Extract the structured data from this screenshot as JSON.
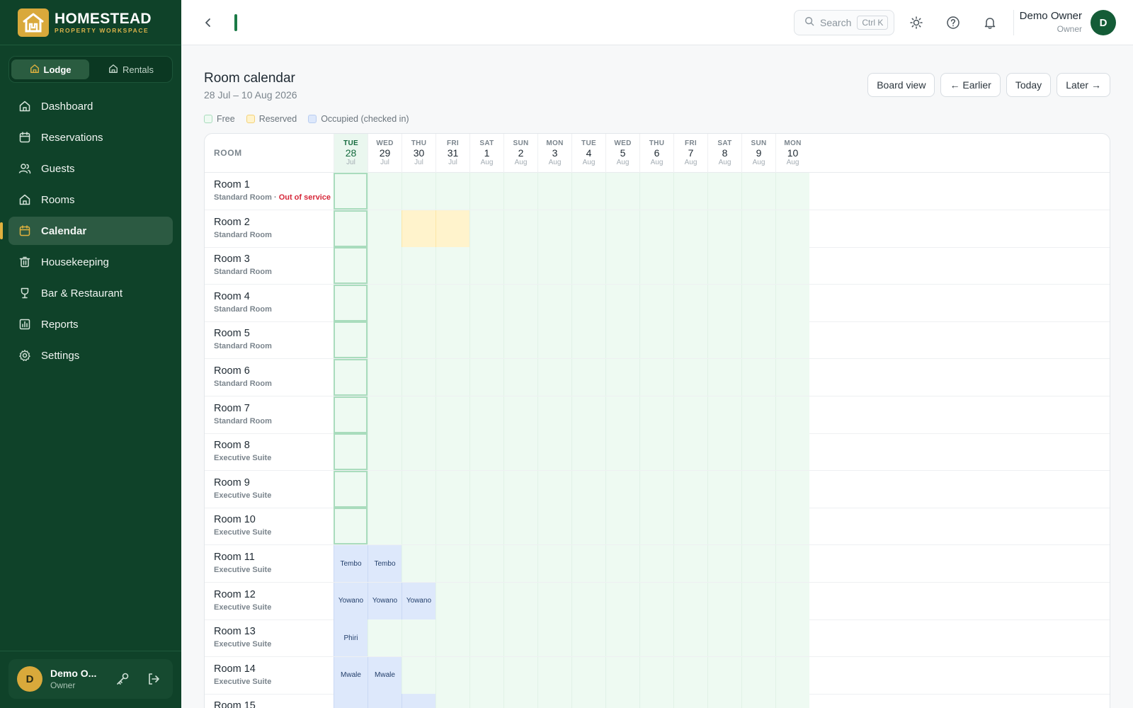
{
  "brand": {
    "name": "HOMESTEAD",
    "tagline": "PROPERTY WORKSPACE"
  },
  "switcher": [
    {
      "label": "Lodge",
      "active": true
    },
    {
      "label": "Rentals",
      "active": false
    }
  ],
  "nav": [
    {
      "label": "Dashboard",
      "icon": "home-icon",
      "active": false
    },
    {
      "label": "Reservations",
      "icon": "calendar-icon",
      "active": false
    },
    {
      "label": "Guests",
      "icon": "users-icon",
      "active": false
    },
    {
      "label": "Rooms",
      "icon": "home-icon",
      "active": false
    },
    {
      "label": "Calendar",
      "icon": "calendar-icon",
      "active": true
    },
    {
      "label": "Housekeeping",
      "icon": "trash-icon",
      "active": false
    },
    {
      "label": "Bar & Restaurant",
      "icon": "wine-glass-icon",
      "active": false
    },
    {
      "label": "Reports",
      "icon": "bar-chart-icon",
      "active": false
    },
    {
      "label": "Settings",
      "icon": "gear-icon",
      "active": false
    }
  ],
  "sidebar_user": {
    "initial": "D",
    "name": "Demo O...",
    "role": "Owner"
  },
  "topbar": {
    "search_label": "Search",
    "search_shortcut": "Ctrl K",
    "user_name": "Demo Owner",
    "user_role": "Owner",
    "user_initial": "D"
  },
  "page": {
    "title": "Room calendar",
    "date_range": "28 Jul – 10 Aug 2026",
    "buttons": {
      "board_view": "Board view",
      "earlier": "← Earlier",
      "today": "Today",
      "later": "Later →"
    }
  },
  "legend": [
    {
      "label": "Free",
      "color": "#a9dcbd",
      "fill": "#eefaf2"
    },
    {
      "label": "Reserved",
      "color": "#f3d27a",
      "fill": "#fff3cc"
    },
    {
      "label": "Occupied (checked in)",
      "color": "#b9cdf0",
      "fill": "#dde8fb"
    }
  ],
  "calendar": {
    "room_header": "ROOM",
    "days": [
      {
        "dow": "TUE",
        "num": "28",
        "mon": "Jul",
        "today": true
      },
      {
        "dow": "WED",
        "num": "29",
        "mon": "Jul"
      },
      {
        "dow": "THU",
        "num": "30",
        "mon": "Jul"
      },
      {
        "dow": "FRI",
        "num": "31",
        "mon": "Jul"
      },
      {
        "dow": "SAT",
        "num": "1",
        "mon": "Aug"
      },
      {
        "dow": "SUN",
        "num": "2",
        "mon": "Aug"
      },
      {
        "dow": "MON",
        "num": "3",
        "mon": "Aug"
      },
      {
        "dow": "TUE",
        "num": "4",
        "mon": "Aug"
      },
      {
        "dow": "WED",
        "num": "5",
        "mon": "Aug"
      },
      {
        "dow": "THU",
        "num": "6",
        "mon": "Aug"
      },
      {
        "dow": "FRI",
        "num": "7",
        "mon": "Aug"
      },
      {
        "dow": "SAT",
        "num": "8",
        "mon": "Aug"
      },
      {
        "dow": "SUN",
        "num": "9",
        "mon": "Aug"
      },
      {
        "dow": "MON",
        "num": "10",
        "mon": "Aug"
      }
    ],
    "rooms": [
      {
        "name": "Room 1",
        "type": "Standard Room",
        "note": "Out of service",
        "bookings": []
      },
      {
        "name": "Room 2",
        "type": "Standard Room",
        "bookings": [
          {
            "day": 2,
            "status": "reserved",
            "guest": ""
          },
          {
            "day": 3,
            "status": "reserved",
            "guest": ""
          }
        ]
      },
      {
        "name": "Room 3",
        "type": "Standard Room",
        "bookings": []
      },
      {
        "name": "Room 4",
        "type": "Standard Room",
        "bookings": []
      },
      {
        "name": "Room 5",
        "type": "Standard Room",
        "bookings": []
      },
      {
        "name": "Room 6",
        "type": "Standard Room",
        "bookings": []
      },
      {
        "name": "Room 7",
        "type": "Standard Room",
        "bookings": []
      },
      {
        "name": "Room 8",
        "type": "Executive Suite",
        "bookings": []
      },
      {
        "name": "Room 9",
        "type": "Executive Suite",
        "bookings": []
      },
      {
        "name": "Room 10",
        "type": "Executive Suite",
        "bookings": []
      },
      {
        "name": "Room 11",
        "type": "Executive Suite",
        "bookings": [
          {
            "day": 0,
            "status": "occupied",
            "guest": "Tembo"
          },
          {
            "day": 1,
            "status": "occupied",
            "guest": "Tembo"
          }
        ]
      },
      {
        "name": "Room 12",
        "type": "Executive Suite",
        "bookings": [
          {
            "day": 0,
            "status": "occupied",
            "guest": "Yowano"
          },
          {
            "day": 1,
            "status": "occupied",
            "guest": "Yowano"
          },
          {
            "day": 2,
            "status": "occupied",
            "guest": "Yowano"
          }
        ]
      },
      {
        "name": "Room 13",
        "type": "Executive Suite",
        "bookings": [
          {
            "day": 0,
            "status": "occupied",
            "guest": "Phiri"
          }
        ]
      },
      {
        "name": "Room 14",
        "type": "Executive Suite",
        "bookings": [
          {
            "day": 0,
            "status": "occupied",
            "guest": "Mwale"
          },
          {
            "day": 1,
            "status": "occupied",
            "guest": "Mwale"
          }
        ]
      },
      {
        "name": "Room 15",
        "type": "",
        "bookings": [
          {
            "day": 0,
            "status": "occupied",
            "guest": ""
          },
          {
            "day": 1,
            "status": "occupied",
            "guest": ""
          },
          {
            "day": 2,
            "status": "occupied",
            "guest": ""
          }
        ]
      }
    ]
  }
}
